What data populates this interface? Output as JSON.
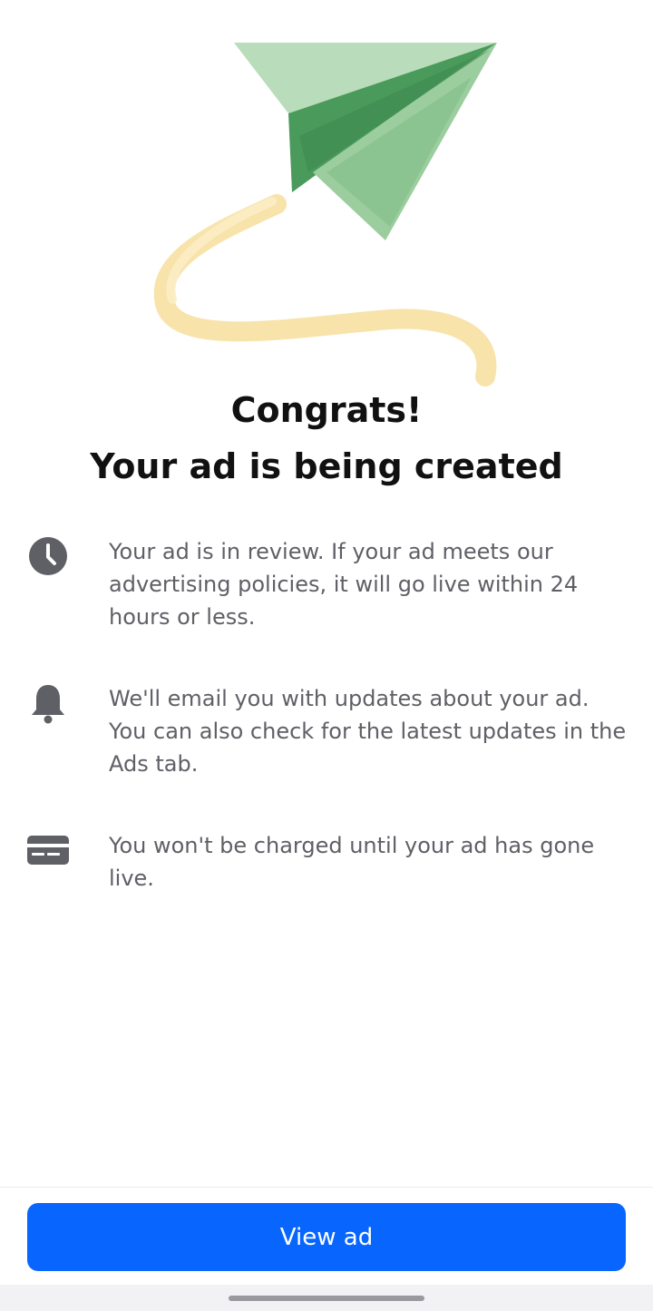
{
  "title": {
    "line1": "Congrats!",
    "line2": "Your ad is being created"
  },
  "info_items": [
    {
      "icon": "clock-icon",
      "text": "Your ad is in review. If your ad meets our advertising policies, it will go live within 24 hours or less."
    },
    {
      "icon": "bell-icon",
      "text": "We'll email you with updates about your ad. You can also check for the latest updates in the Ads tab."
    },
    {
      "icon": "credit-card-icon",
      "text": "You won't be charged until your ad has gone live."
    }
  ],
  "footer": {
    "view_ad_label": "View ad"
  },
  "colors": {
    "primary_button": "#0866ff",
    "icon_gray": "#5f5f66",
    "plane_light": "#b9dcba",
    "plane_dark": "#4a9a5b",
    "trail": "#f8e2a6"
  }
}
